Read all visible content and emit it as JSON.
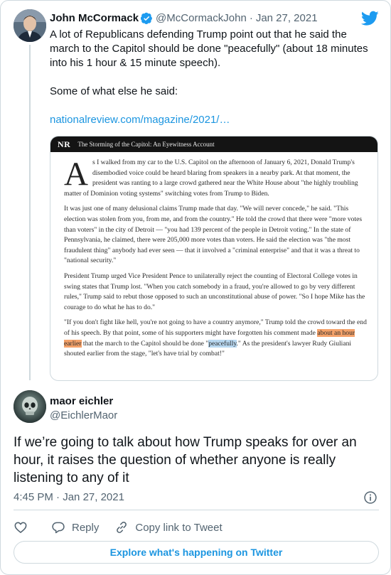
{
  "quoted_tweet": {
    "author_name": "John McCormack",
    "handle": "@McCormackJohn",
    "separator": "·",
    "date": "Jan 27, 2021",
    "text_para1": "A lot of Republicans defending Trump point out that he said the march to the Capitol should be done \"peacefully\" (about 18 minutes into his 1 hour & 15 minute speech).",
    "text_para2": "Some of what else he said:",
    "link": "nationalreview.com/magazine/2021/…",
    "avatar_icon": "person-photo-icon",
    "verified_icon": "verified-badge-icon",
    "brand_icon": "twitter-bird-icon"
  },
  "article": {
    "logo": "NR",
    "title": "The Storming of the Capitol: An Eyewitness Account",
    "dropcap": "A",
    "p1": "s I walked from my car to the U.S. Capitol on the afternoon of January 6, 2021, Donald Trump's disembodied voice could be heard blaring from speakers in a nearby park. At that moment, the president was ranting to a large crowd gathered near the White House about \"the highly troubling matter of Dominion voting systems\" switching votes from Trump to Biden.",
    "p2": "It was just one of many delusional claims Trump made that day. \"We will never concede,\" he said. \"This election was stolen from you, from me, and from the country.\" He told the crowd that there were \"more votes than voters\" in the city of Detroit — \"you had 139 percent of the people in Detroit voting.\" In the state of Pennsylvania, he claimed, there were 205,000 more votes than voters. He said the election was \"the most fraudulent thing\" anybody had ever seen — that it involved a \"criminal enterprise\" and that it was a threat to \"national security.\"",
    "p3": "President Trump urged Vice President Pence to unilaterally reject the counting of Electoral College votes in swing states that Trump lost. \"When you catch somebody in a fraud, you're allowed to go by very different rules,\" Trump said to rebut those opposed to such an unconstitutional abuse of power. \"So I hope Mike has the courage to do what he has to do.\"",
    "p4_a": "\"If you don't fight like hell, you're not going to have a country anymore,\" Trump told the crowd toward the end of his speech. By that point, some of his supporters might have forgotten his comment made ",
    "p4_hl1": "about an hour earlier",
    "p4_b": " that the march to the Capitol should be done \"",
    "p4_hl2": "peacefully",
    "p4_c": ".\" As the president's lawyer Rudy Giuliani shouted earlier from the stage, \"let's have trial by combat!\""
  },
  "reply_tweet": {
    "author_name": "maor eichler",
    "handle": "@EichlerMaor",
    "text": "If we’re going to talk about how Trump speaks for over an hour, it raises the question of whether anyone is really listening to any of it",
    "time": "4:45 PM",
    "separator": "·",
    "date": "Jan 27, 2021",
    "avatar_icon": "skull-photo-icon"
  },
  "actions": {
    "like_icon": "heart-icon",
    "reply_label": "Reply",
    "reply_icon": "reply-bubble-icon",
    "copy_label": "Copy link to Tweet",
    "copy_icon": "link-icon"
  },
  "explore_label": "Explore what's happening on Twitter",
  "colors": {
    "accent": "#1b95e0",
    "verified": "#1d9bf0",
    "secondary_text": "#536471",
    "border": "#cfd9de",
    "highlight_orange": "#f5a26a",
    "highlight_blue": "#b9d9f2"
  }
}
